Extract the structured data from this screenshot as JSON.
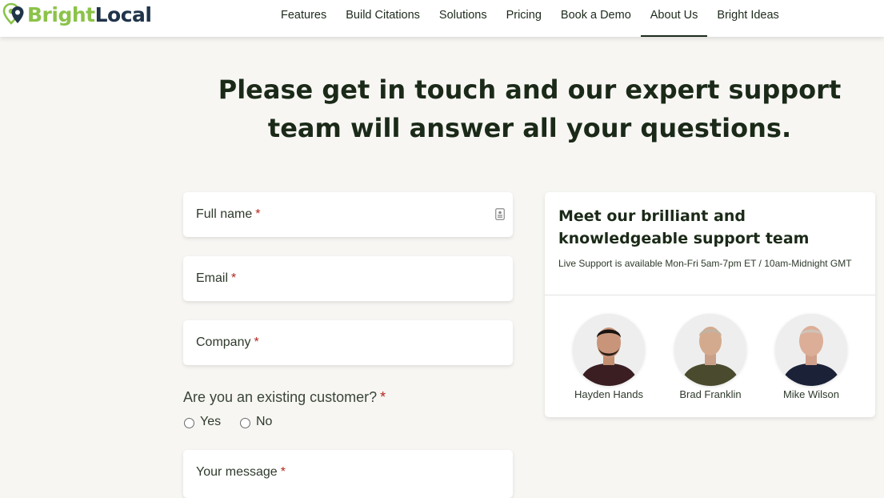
{
  "brand": {
    "name_part1": "Bright",
    "name_part2": "Local",
    "green": "#8bc34a",
    "navy": "#20344a"
  },
  "nav": {
    "items": [
      "Features",
      "Build Citations",
      "Solutions",
      "Pricing",
      "Book a Demo",
      "About Us",
      "Bright Ideas"
    ],
    "active": "About Us"
  },
  "headline": {
    "line1": "Please get in touch and our expert support",
    "line2": "team will answer all your questions."
  },
  "form": {
    "full_name": {
      "label": "Full name",
      "required": "*",
      "icon": "contact-card-icon"
    },
    "email": {
      "label": "Email",
      "required": "*"
    },
    "company": {
      "label": "Company",
      "required": "*"
    },
    "existing_customer": {
      "question": "Are you an existing customer?",
      "required": "*",
      "options": [
        "Yes",
        "No"
      ],
      "selected": null
    },
    "message": {
      "label": "Your message",
      "required": "*"
    }
  },
  "support": {
    "title": "Meet our brilliant and knowledgeable support team",
    "subtitle": "Live Support is available Mon-Fri 5am-7pm ET / 10am-Midnight GMT",
    "team": [
      {
        "name": "Hayden Hands"
      },
      {
        "name": "Brad Franklin"
      },
      {
        "name": "Mike Wilson"
      }
    ]
  }
}
